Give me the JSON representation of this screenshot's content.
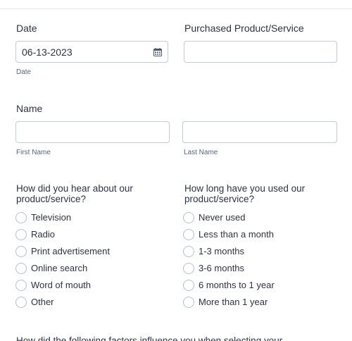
{
  "date_field": {
    "label": "Date",
    "value": "06-13-2023",
    "sublabel": "Date",
    "icon": "calendar-icon"
  },
  "product_field": {
    "label": "Purchased Product/Service",
    "value": ""
  },
  "name_field": {
    "label": "Name",
    "first_sublabel": "First Name",
    "last_sublabel": "Last Name",
    "first_value": "",
    "last_value": ""
  },
  "hear_question": {
    "label": "How did you hear about our product/service?",
    "options": [
      "Television",
      "Radio",
      "Print advertisement",
      "Online search",
      "Word of mouth",
      "Other"
    ]
  },
  "duration_question": {
    "label": "How long have you used our product/service?",
    "options": [
      "Never used",
      "Less than a month",
      "1-3 months",
      "3-6 months",
      "6 months to 1 year",
      "More than 1 year"
    ]
  },
  "next_question": {
    "label": "How did the following factors influence you when selecting your"
  }
}
